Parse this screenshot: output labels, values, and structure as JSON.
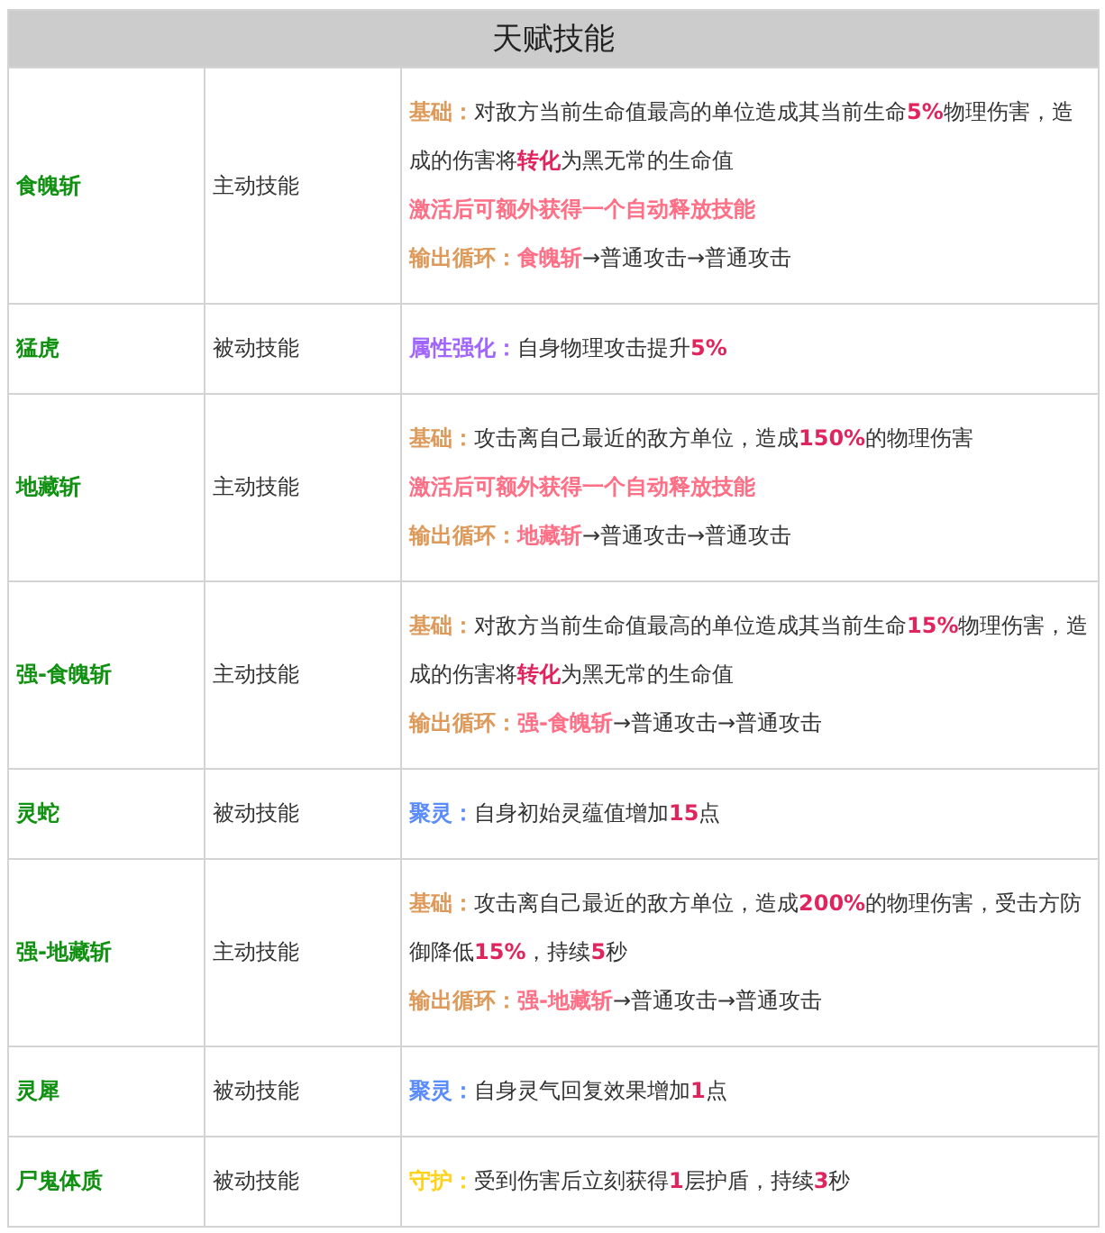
{
  "table": {
    "title": "天赋技能",
    "rows": [
      {
        "name": "食魄斩",
        "type": "主动技能",
        "lines": [
          [
            {
              "kind": "label",
              "text": "基础：",
              "color": "#dd9a5a"
            },
            {
              "kind": "plain",
              "text": "对敌方当前生命值最高的单位造成其当前生命"
            },
            {
              "kind": "value",
              "text": "5%"
            },
            {
              "kind": "plain",
              "text": "物理伤害，造成的伤害将"
            },
            {
              "kind": "value",
              "text": "转化"
            },
            {
              "kind": "plain",
              "text": "为黑无常的生命值"
            }
          ],
          [
            {
              "kind": "skill",
              "text": "激活后可额外获得一个自动释放技能"
            }
          ],
          [
            {
              "kind": "label",
              "text": "输出循环：",
              "color": "#dd9a5a"
            },
            {
              "kind": "skill",
              "text": "食魄斩"
            },
            {
              "kind": "plain",
              "text": "→普通攻击→普通攻击"
            }
          ]
        ]
      },
      {
        "name": "猛虎",
        "type": "被动技能",
        "lines": [
          [
            {
              "kind": "label",
              "text": "属性强化：",
              "color": "#a066ff"
            },
            {
              "kind": "plain",
              "text": "自身物理攻击提升"
            },
            {
              "kind": "value",
              "text": "5%"
            }
          ]
        ]
      },
      {
        "name": "地藏斩",
        "type": "主动技能",
        "lines": [
          [
            {
              "kind": "label",
              "text": "基础：",
              "color": "#dd9a5a"
            },
            {
              "kind": "plain",
              "text": "攻击离自己最近的敌方单位，造成"
            },
            {
              "kind": "value",
              "text": "150%"
            },
            {
              "kind": "plain",
              "text": "的物理伤害"
            }
          ],
          [
            {
              "kind": "skill",
              "text": "激活后可额外获得一个自动释放技能"
            }
          ],
          [
            {
              "kind": "label",
              "text": "输出循环：",
              "color": "#dd9a5a"
            },
            {
              "kind": "skill",
              "text": "地藏斩"
            },
            {
              "kind": "plain",
              "text": "→普通攻击→普通攻击"
            }
          ]
        ]
      },
      {
        "name": "强-食魄斩",
        "type": "主动技能",
        "lines": [
          [
            {
              "kind": "label",
              "text": "基础：",
              "color": "#dd9a5a"
            },
            {
              "kind": "plain",
              "text": "对敌方当前生命值最高的单位造成其当前生命"
            },
            {
              "kind": "value",
              "text": "15%"
            },
            {
              "kind": "plain",
              "text": "物理伤害，造成的伤害将"
            },
            {
              "kind": "value",
              "text": "转化"
            },
            {
              "kind": "plain",
              "text": "为黑无常的生命值"
            }
          ],
          [
            {
              "kind": "label",
              "text": "输出循环：",
              "color": "#dd9a5a"
            },
            {
              "kind": "skill",
              "text": "强-食魄斩"
            },
            {
              "kind": "plain",
              "text": "→普通攻击→普通攻击"
            }
          ]
        ]
      },
      {
        "name": "灵蛇",
        "type": "被动技能",
        "lines": [
          [
            {
              "kind": "label",
              "text": "聚灵：",
              "color": "#5b8cff"
            },
            {
              "kind": "plain",
              "text": "自身初始灵蕴值增加"
            },
            {
              "kind": "value",
              "text": "15"
            },
            {
              "kind": "plain",
              "text": "点"
            }
          ]
        ]
      },
      {
        "name": "强-地藏斩",
        "type": "主动技能",
        "lines": [
          [
            {
              "kind": "label",
              "text": "基础：",
              "color": "#dd9a5a"
            },
            {
              "kind": "plain",
              "text": "攻击离自己最近的敌方单位，造成"
            },
            {
              "kind": "value",
              "text": "200%"
            },
            {
              "kind": "plain",
              "text": "的物理伤害，受击方防御降低"
            },
            {
              "kind": "value",
              "text": "15%"
            },
            {
              "kind": "plain",
              "text": "，持续"
            },
            {
              "kind": "value",
              "text": "5"
            },
            {
              "kind": "plain",
              "text": "秒"
            }
          ],
          [
            {
              "kind": "label",
              "text": "输出循环：",
              "color": "#dd9a5a"
            },
            {
              "kind": "skill",
              "text": "强-地藏斩"
            },
            {
              "kind": "plain",
              "text": "→普通攻击→普通攻击"
            }
          ]
        ]
      },
      {
        "name": "灵犀",
        "type": "被动技能",
        "lines": [
          [
            {
              "kind": "label",
              "text": "聚灵：",
              "color": "#5b8cff"
            },
            {
              "kind": "plain",
              "text": "自身灵气回复效果增加"
            },
            {
              "kind": "value",
              "text": "1"
            },
            {
              "kind": "plain",
              "text": "点"
            }
          ]
        ]
      },
      {
        "name": "尸鬼体质",
        "type": "被动技能",
        "lines": [
          [
            {
              "kind": "label",
              "text": "守护：",
              "color": "#ffd21a"
            },
            {
              "kind": "plain",
              "text": "受到伤害后立刻获得"
            },
            {
              "kind": "value",
              "text": "1"
            },
            {
              "kind": "plain",
              "text": "层护盾，持续"
            },
            {
              "kind": "value",
              "text": "3"
            },
            {
              "kind": "plain",
              "text": "秒"
            }
          ]
        ]
      }
    ]
  }
}
